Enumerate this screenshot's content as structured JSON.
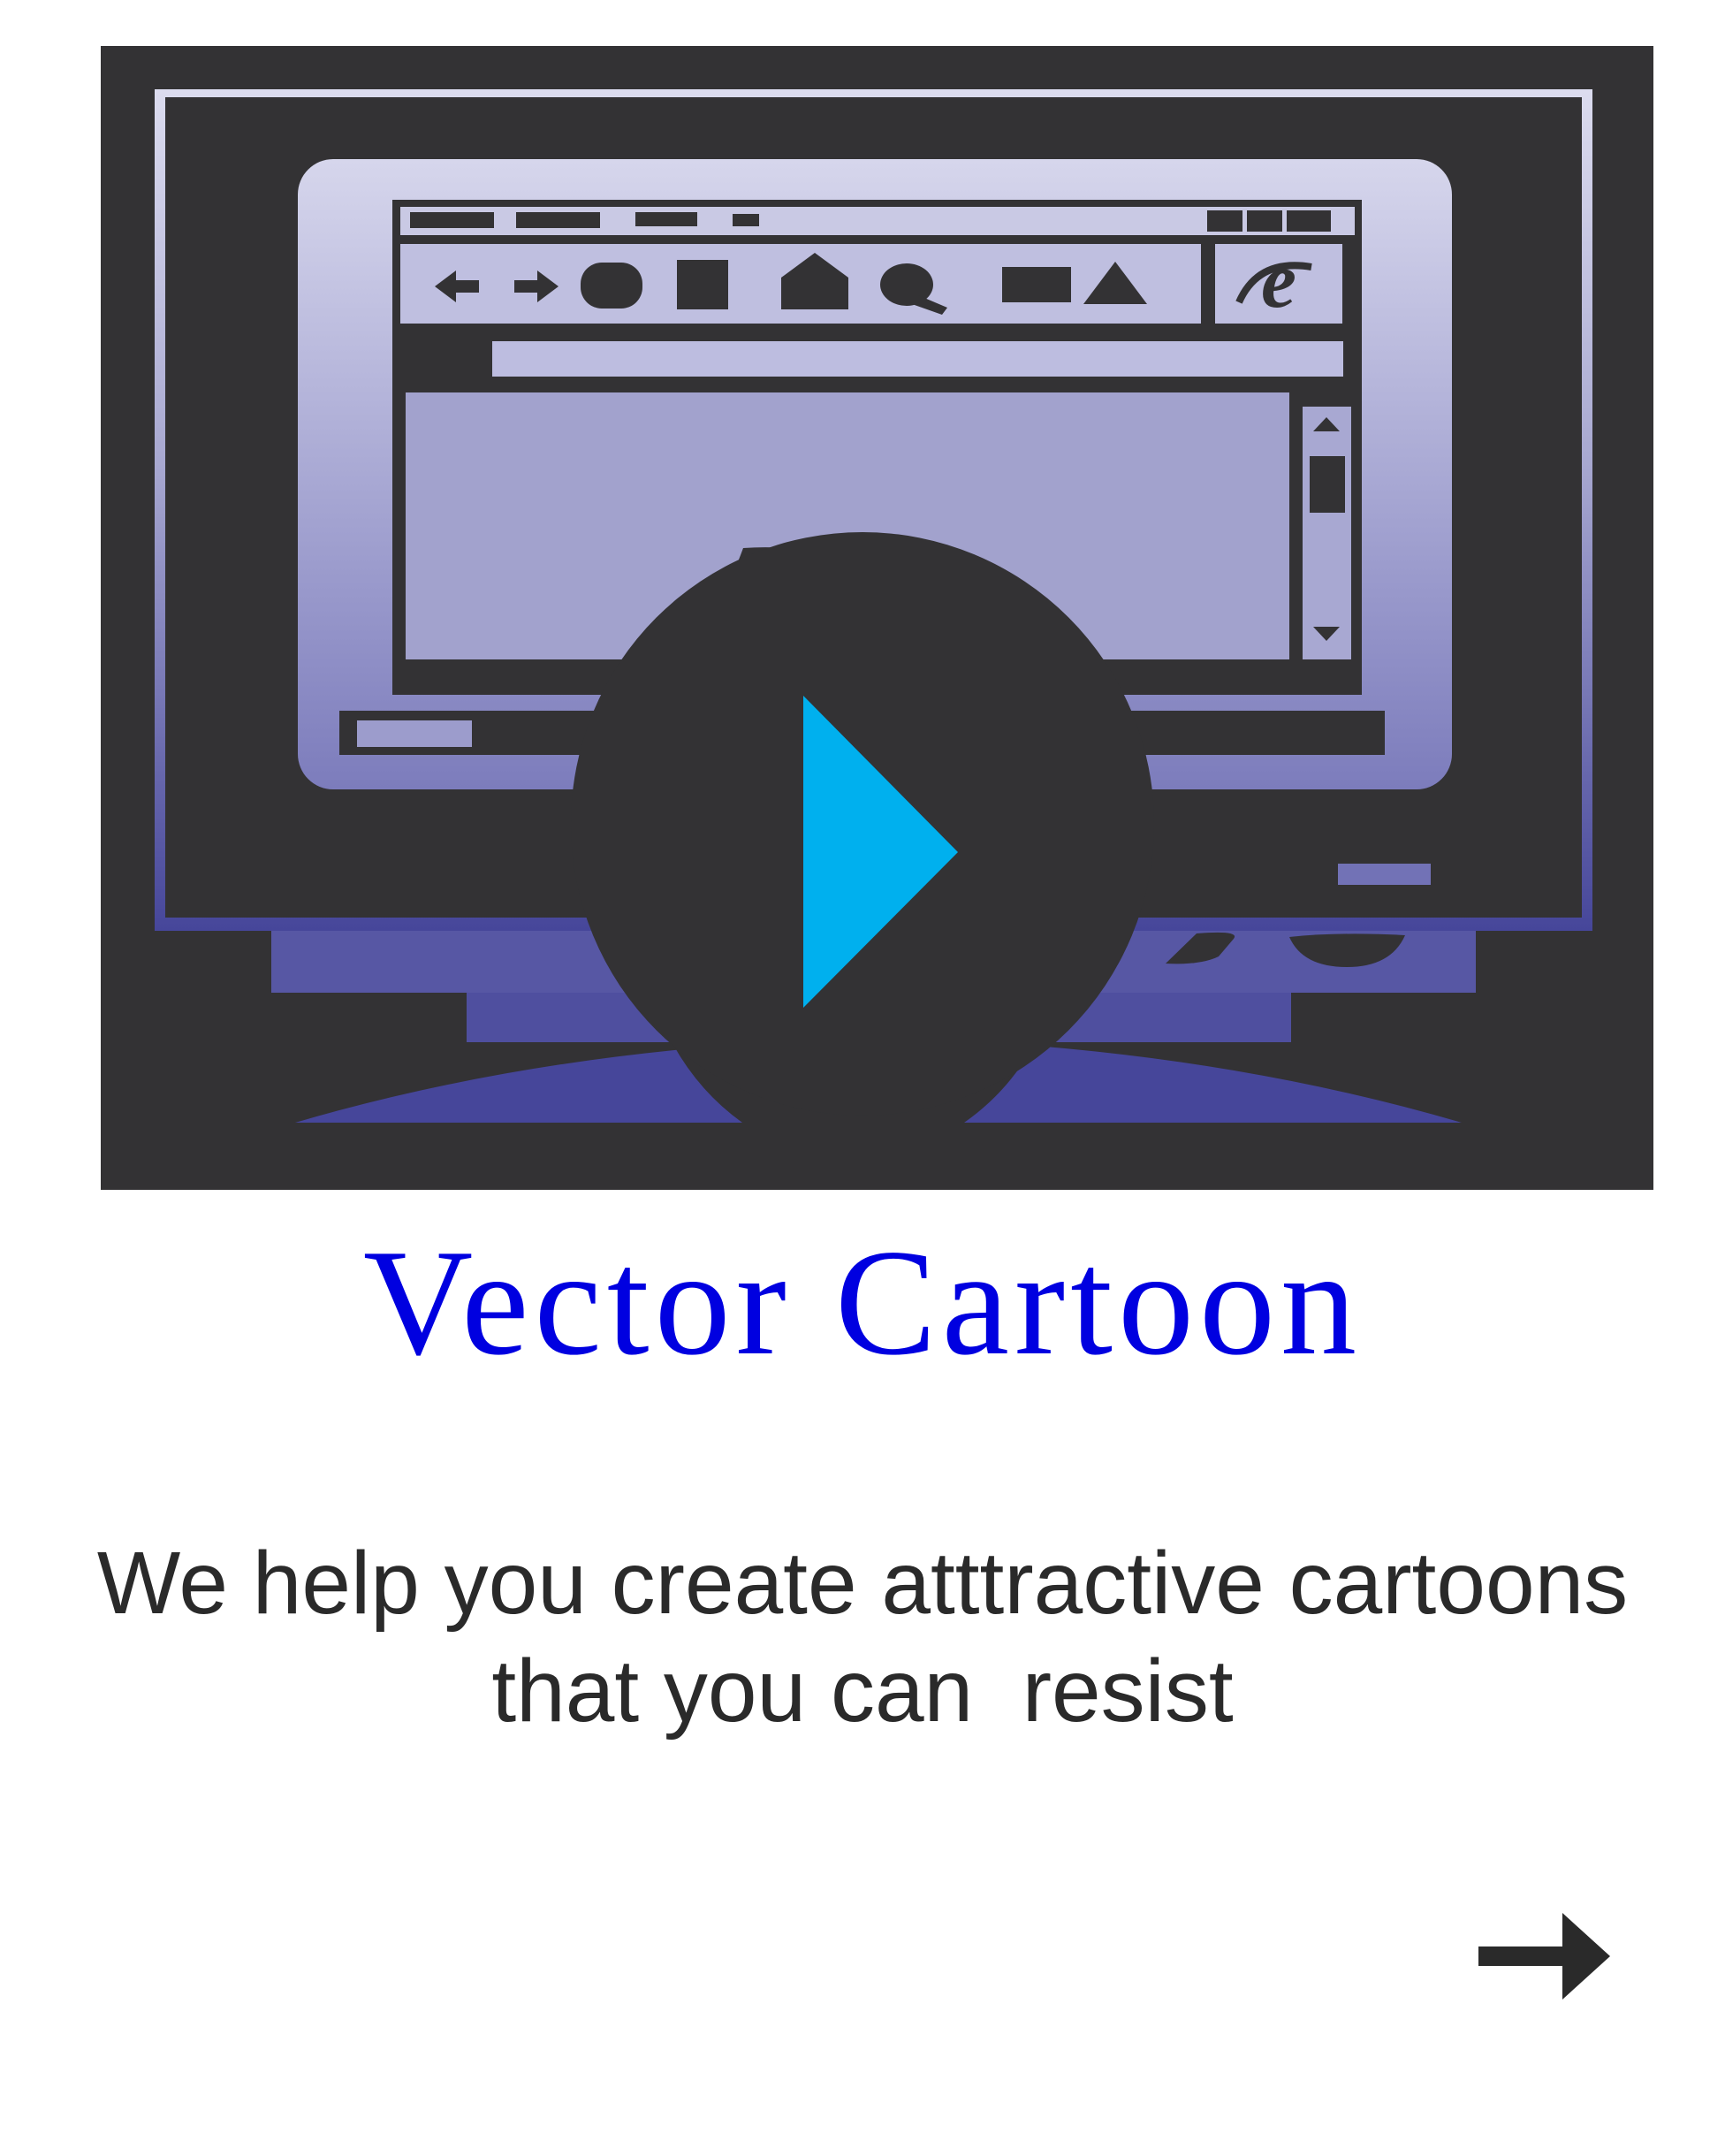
{
  "hero": {
    "icon": "monitor-browser-video-icon",
    "colors": {
      "background": "#333234",
      "screen_top": "#dcdcef",
      "screen_bottom": "#4a4a9c",
      "play_triangle": "#00b0ee"
    }
  },
  "title": "Vector Cartoon",
  "subtitle": {
    "line1": "We help you create atttractive cartoons",
    "line2": "that you can  resist"
  },
  "next_button": {
    "icon": "arrow-right-icon"
  },
  "colors": {
    "title": "#0000e0",
    "text": "#2a2a2a",
    "page_background": "#ffffff"
  }
}
